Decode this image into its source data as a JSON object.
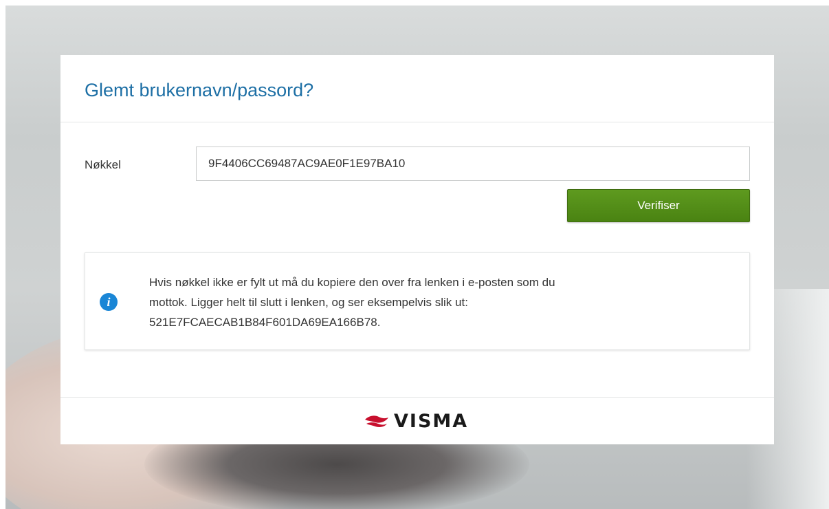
{
  "page": {
    "title": "Glemt brukernavn/passord?"
  },
  "form": {
    "key_label": "Nøkkel",
    "key_value": "9F4406CC69487AC9AE0F1E97BA10",
    "verify_label": "Verifiser"
  },
  "info": {
    "icon": "info-icon",
    "line1": "Hvis nøkkel ikke er fylt ut må du kopiere den over fra lenken i e-posten som du",
    "line2": "mottok. Ligger helt til slutt i lenken, og ser eksempelvis slik ut:",
    "line3": "521E7FCAECAB1B84F601DA69EA166B78."
  },
  "footer": {
    "brand": "VISMA",
    "brand_color": "#c8102e"
  },
  "colors": {
    "title": "#1d6fa5",
    "button": "#4a8312",
    "info_icon": "#1a86d6"
  }
}
